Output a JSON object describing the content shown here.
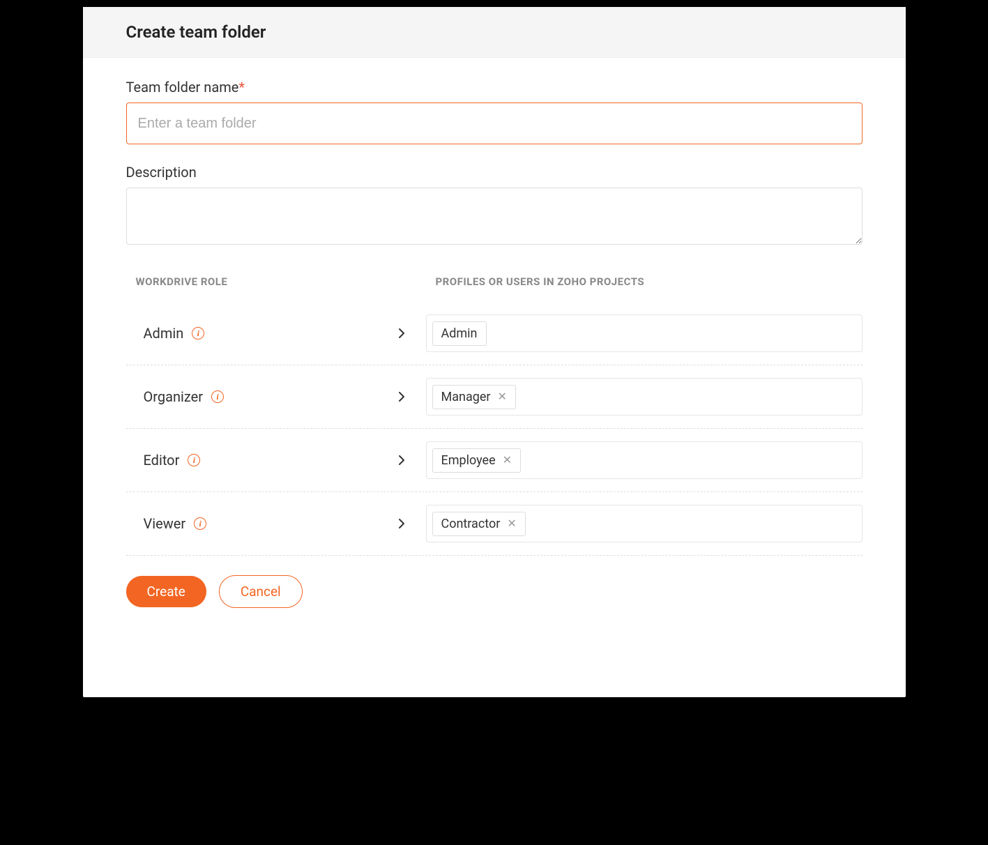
{
  "header": {
    "title": "Create team folder"
  },
  "form": {
    "name_label": "Team folder name",
    "name_placeholder": "Enter a team folder",
    "name_value": "",
    "desc_label": "Description",
    "desc_value": ""
  },
  "roles": {
    "col_left_header": "WORKDRIVE ROLE",
    "col_right_header": "PROFILES OR USERS IN ZOHO PROJECTS",
    "rows": [
      {
        "role": "Admin",
        "tags": [
          {
            "label": "Admin",
            "removable": false
          }
        ]
      },
      {
        "role": "Organizer",
        "tags": [
          {
            "label": "Manager",
            "removable": true
          }
        ]
      },
      {
        "role": "Editor",
        "tags": [
          {
            "label": "Employee",
            "removable": true
          }
        ]
      },
      {
        "role": "Viewer",
        "tags": [
          {
            "label": "Contractor",
            "removable": true
          }
        ]
      }
    ]
  },
  "footer": {
    "create_label": "Create",
    "cancel_label": "Cancel"
  }
}
